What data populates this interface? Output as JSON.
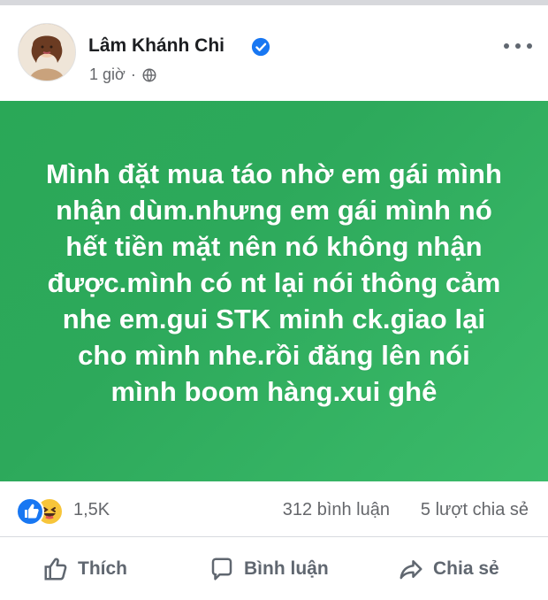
{
  "post": {
    "author": "Lâm Khánh Chi",
    "timestamp": "1 giờ",
    "separator": "·",
    "privacy_icon": "globe-icon",
    "more_icon": "more-horizontal-icon",
    "text": "Mình đặt mua táo nhờ em gái mình nhận dùm.nhưng em gái mình nó hết tiền mặt nên nó không nhận được.mình có nt lại nói thông cảm nhe em.gui STK minh ck.giao lại cho mình nhe.rồi đăng lên nói mình boom hàng.xui ghê",
    "background_color": "#2ea95b",
    "text_color": "#ffffff"
  },
  "stats": {
    "reactions": [
      "like",
      "haha"
    ],
    "reaction_count": "1,5K",
    "comments": "312 bình luận",
    "shares": "5 lượt chia sẻ"
  },
  "actions": {
    "like": "Thích",
    "comment": "Bình luận",
    "share": "Chia sẻ"
  },
  "colors": {
    "like_blue": "#1877f2",
    "verified_blue": "#1877f2",
    "meta_gray": "#65676b"
  }
}
